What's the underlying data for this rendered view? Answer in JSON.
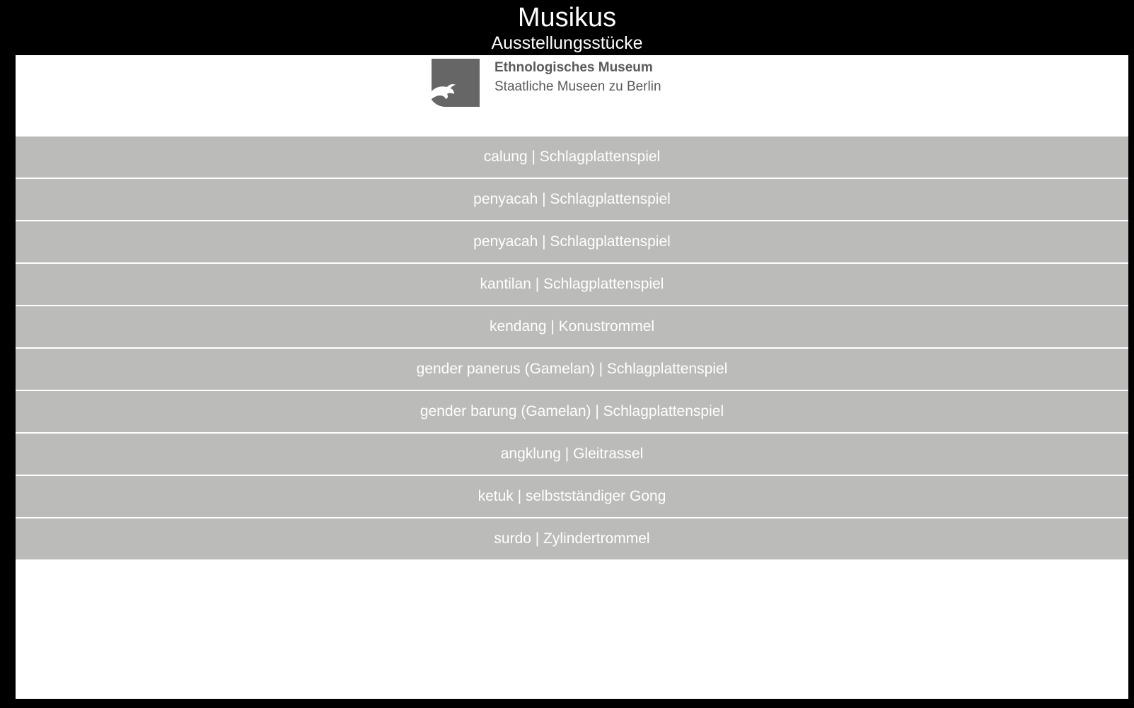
{
  "header": {
    "title": "Musikus",
    "subtitle": "Ausstellungsstücke"
  },
  "logo": {
    "line1": "Ethnologisches Museum",
    "line2": "Staatliche Museen zu Berlin",
    "mark_icon": "eagle-icon",
    "color": "#5a5a5a"
  },
  "exhibits": [
    "calung | Schlagplattenspiel",
    "penyacah | Schlagplattenspiel",
    "penyacah | Schlagplattenspiel",
    "kantilan | Schlagplattenspiel",
    "kendang | Konustrommel",
    "gender panerus (Gamelan) | Schlagplattenspiel",
    "gender barung (Gamelan) | Schlagplattenspiel",
    "angklung | Gleitrassel",
    "ketuk | selbstständiger Gong",
    "surdo | Zylindertrommel"
  ],
  "colors": {
    "background": "#000000",
    "list_item": "#bbbbb9",
    "list_text": "#ffffff",
    "content": "#ffffff"
  }
}
